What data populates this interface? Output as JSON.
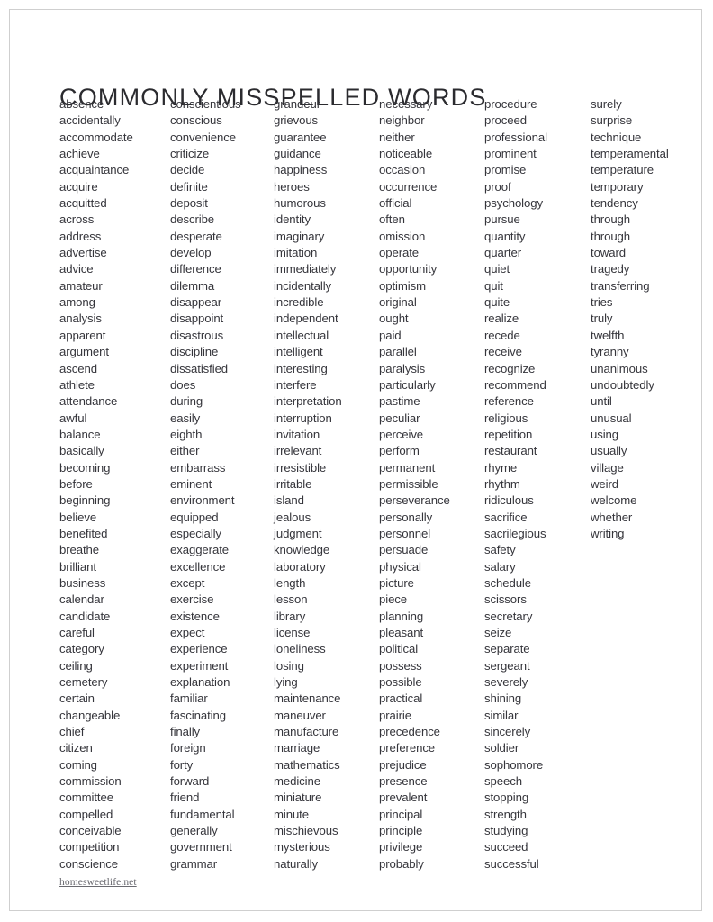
{
  "document": {
    "title": "COMMONLY MISSPELLED WORDS",
    "footer": "homesweetlife.net",
    "colors": {
      "text": "#35353b",
      "title": "#2b2b2f",
      "footer": "#6a6a70",
      "page_border": "#cfcfcf",
      "background": "#ffffff"
    }
  },
  "columns": [
    {
      "index": 1,
      "words": [
        "absence",
        "accidentally",
        "accommodate",
        "achieve",
        "acquaintance",
        "acquire",
        "acquitted",
        "across",
        "address",
        "advertise",
        "advice",
        "amateur",
        "among",
        "analysis",
        "apparent",
        "argument",
        "ascend",
        "athlete",
        "attendance",
        "awful",
        "balance",
        "basically",
        "becoming",
        "before",
        "beginning",
        "believe",
        "benefited",
        "breathe",
        "brilliant",
        "business",
        "calendar",
        "candidate",
        "careful",
        "category",
        "ceiling",
        "cemetery",
        "certain",
        "changeable",
        "chief",
        "citizen",
        "coming",
        "commission",
        "committee",
        "compelled",
        "conceivable",
        "competition",
        "conscience"
      ]
    },
    {
      "index": 2,
      "words": [
        "conscientious",
        "conscious",
        "convenience",
        "criticize",
        "decide",
        "definite",
        "deposit",
        "describe",
        "desperate",
        "develop",
        "difference",
        "dilemma",
        "disappear",
        "disappoint",
        "disastrous",
        "discipline",
        "dissatisfied",
        "does",
        "during",
        "easily",
        "eighth",
        "either",
        "embarrass",
        "eminent",
        "environment",
        "equipped",
        "especially",
        "exaggerate",
        "excellence",
        "except",
        "exercise",
        "existence",
        "expect",
        "experience",
        "experiment",
        "explanation",
        "familiar",
        "fascinating",
        "finally",
        "foreign",
        "forty",
        "forward",
        "friend",
        "fundamental",
        "generally",
        "government",
        "grammar"
      ]
    },
    {
      "index": 3,
      "words": [
        "grandeur",
        "grievous",
        "guarantee",
        "guidance",
        "happiness",
        "heroes",
        "humorous",
        "identity",
        "imaginary",
        "imitation",
        "immediately",
        "incidentally",
        "incredible",
        "independent",
        "intellectual",
        "intelligent",
        "interesting",
        "interfere",
        "interpretation",
        "interruption",
        "invitation",
        "irrelevant",
        "irresistible",
        "irritable",
        "island",
        "jealous",
        "judgment",
        "knowledge",
        "laboratory",
        "length",
        "lesson",
        "library",
        "license",
        "loneliness",
        "losing",
        "lying",
        "maintenance",
        "maneuver",
        "manufacture",
        "marriage",
        "mathematics",
        "medicine",
        "miniature",
        "minute",
        "mischievous",
        "mysterious",
        "naturally"
      ]
    },
    {
      "index": 4,
      "words": [
        "necessary",
        "neighbor",
        "neither",
        "noticeable",
        "occasion",
        "occurrence",
        "official",
        "often",
        "omission",
        "operate",
        "opportunity",
        "optimism",
        "original",
        "ought",
        "paid",
        "parallel",
        "paralysis",
        "particularly",
        "pastime",
        "peculiar",
        "perceive",
        "perform",
        "permanent",
        "permissible",
        "perseverance",
        "personally",
        "personnel",
        "persuade",
        "physical",
        "picture",
        "piece",
        "planning",
        "pleasant",
        "political",
        "possess",
        "possible",
        "practical",
        "prairie",
        "precedence",
        "preference",
        "prejudice",
        "presence",
        "prevalent",
        "principal",
        "principle",
        "privilege",
        "probably"
      ]
    },
    {
      "index": 5,
      "words": [
        "procedure",
        "proceed",
        "professional",
        "prominent",
        "promise",
        "proof",
        "psychology",
        "pursue",
        "quantity",
        "quarter",
        "quiet",
        "quit",
        "quite",
        "realize",
        "recede",
        "receive",
        "recognize",
        "recommend",
        "reference",
        "religious",
        "repetition",
        "restaurant",
        "rhyme",
        "rhythm",
        "ridiculous",
        "sacrifice",
        "sacrilegious",
        "safety",
        "salary",
        "schedule",
        "scissors",
        "secretary",
        "seize",
        "separate",
        "sergeant",
        "severely",
        "shining",
        "similar",
        "sincerely",
        "soldier",
        "sophomore",
        "speech",
        "stopping",
        "strength",
        "studying",
        "succeed",
        "successful"
      ]
    },
    {
      "index": 6,
      "words": [
        "surely",
        "surprise",
        "technique",
        "temperamental",
        "temperature",
        "temporary",
        "tendency",
        "through",
        "through",
        "toward",
        "tragedy",
        "transferring",
        "tries",
        "truly",
        "twelfth",
        "tyranny",
        "unanimous",
        "undoubtedly",
        "until",
        "unusual",
        "using",
        "usually",
        "village",
        "weird",
        "welcome",
        "whether",
        "writing"
      ]
    }
  ]
}
